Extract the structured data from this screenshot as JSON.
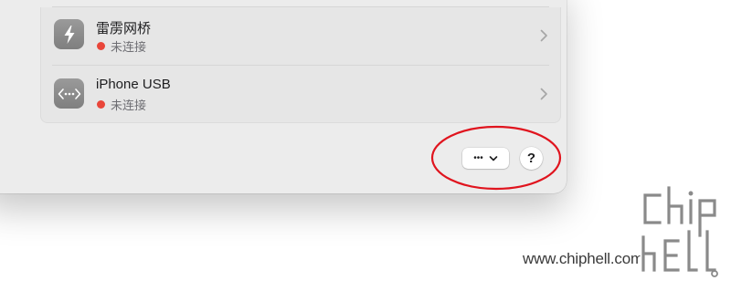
{
  "network_services": [
    {
      "name": "雷雳网桥",
      "status": "未连接",
      "icon": "thunderbolt-icon",
      "status_color": "#e9463a"
    },
    {
      "name": "iPhone USB",
      "status": "未连接",
      "icon": "connector-icon",
      "status_color": "#e9463a"
    }
  ],
  "footer": {
    "more_label": "•••",
    "more_icon": "chevron-down-icon",
    "help_label": "?"
  },
  "annotation": {
    "color": "#e0141e",
    "shape": "ellipse-around-footer-buttons"
  },
  "watermark": {
    "text": "www.chiphell.com",
    "logo_label": "chip hell"
  }
}
